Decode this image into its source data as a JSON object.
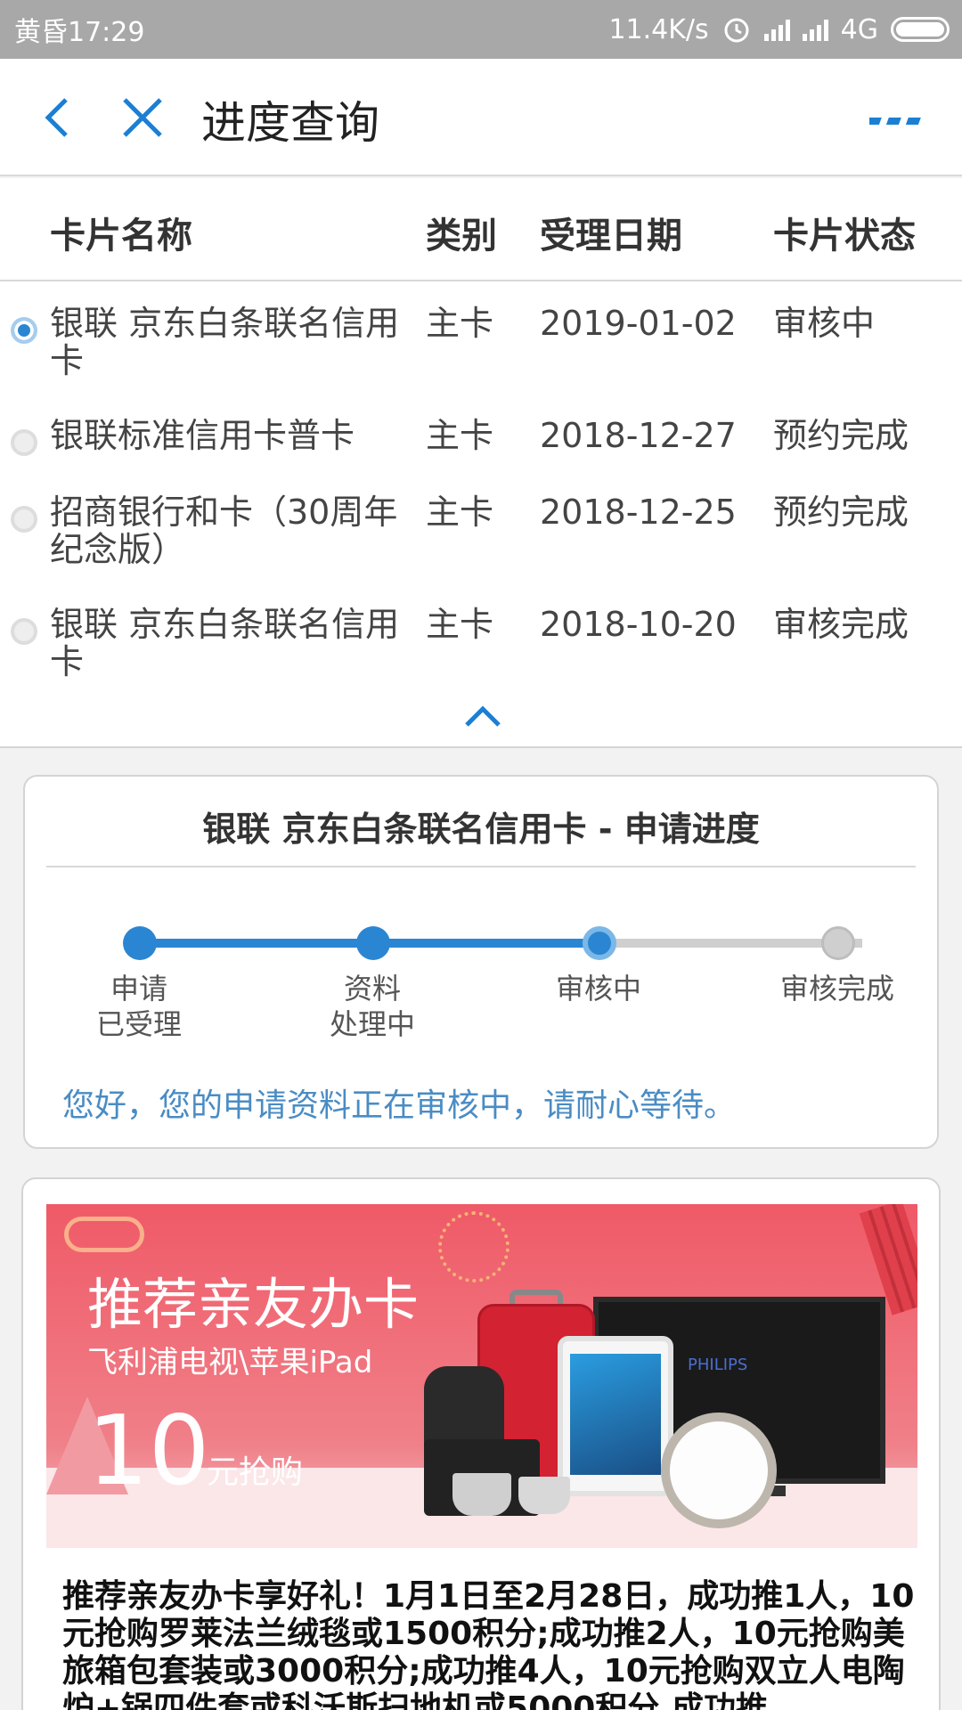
{
  "status_bar": {
    "time": "黄昏17:29",
    "speed": "11.4K/s",
    "network": "4G"
  },
  "nav": {
    "title": "进度查询"
  },
  "table": {
    "headers": [
      "卡片名称",
      "类别",
      "受理日期",
      "卡片状态"
    ],
    "rows": [
      {
        "name": "银联 京东白条联名信用卡",
        "type": "主卡",
        "date": "2019-01-02",
        "status": "审核中",
        "selected": true
      },
      {
        "name": "银联标准信用卡普卡",
        "type": "主卡",
        "date": "2018-12-27",
        "status": "预约完成",
        "selected": false
      },
      {
        "name": "招商银行和卡（30周年纪念版）",
        "type": "主卡",
        "date": "2018-12-25",
        "status": "预约完成",
        "selected": false
      },
      {
        "name": "银联 京东白条联名信用卡",
        "type": "主卡",
        "date": "2018-10-20",
        "status": "审核完成",
        "selected": false
      }
    ]
  },
  "progress": {
    "title": "银联 京东白条联名信用卡 - 申请进度",
    "steps": [
      "申请\n已受理",
      "资料\n处理中",
      "审核中",
      "审核完成"
    ],
    "current_step": 3,
    "message": "您好，您的申请资料正在审核中，请耐心等待。"
  },
  "promo": {
    "banner_title": "推荐亲友办卡",
    "banner_subtitle": "飞利浦电视\\苹果iPad",
    "banner_price": "10",
    "banner_price_suffix": "元抢购",
    "tv_brand": "PHILIPS",
    "text": "推荐亲友办卡享好礼！1月1日至2月28日，成功推1人，10元抢购罗莱法兰绒毯或1500积分;成功推2人，10元抢购美旅箱包套装或3000积分;成功推4人，10元抢购双立人电陶炉+锅四件套或科沃斯扫地机或5000积分,成功推"
  },
  "colors": {
    "accent": "#2a86d3",
    "inactive": "#cfcfcf",
    "message": "#4a8cc4",
    "status_bar": "#a8a8a8"
  }
}
